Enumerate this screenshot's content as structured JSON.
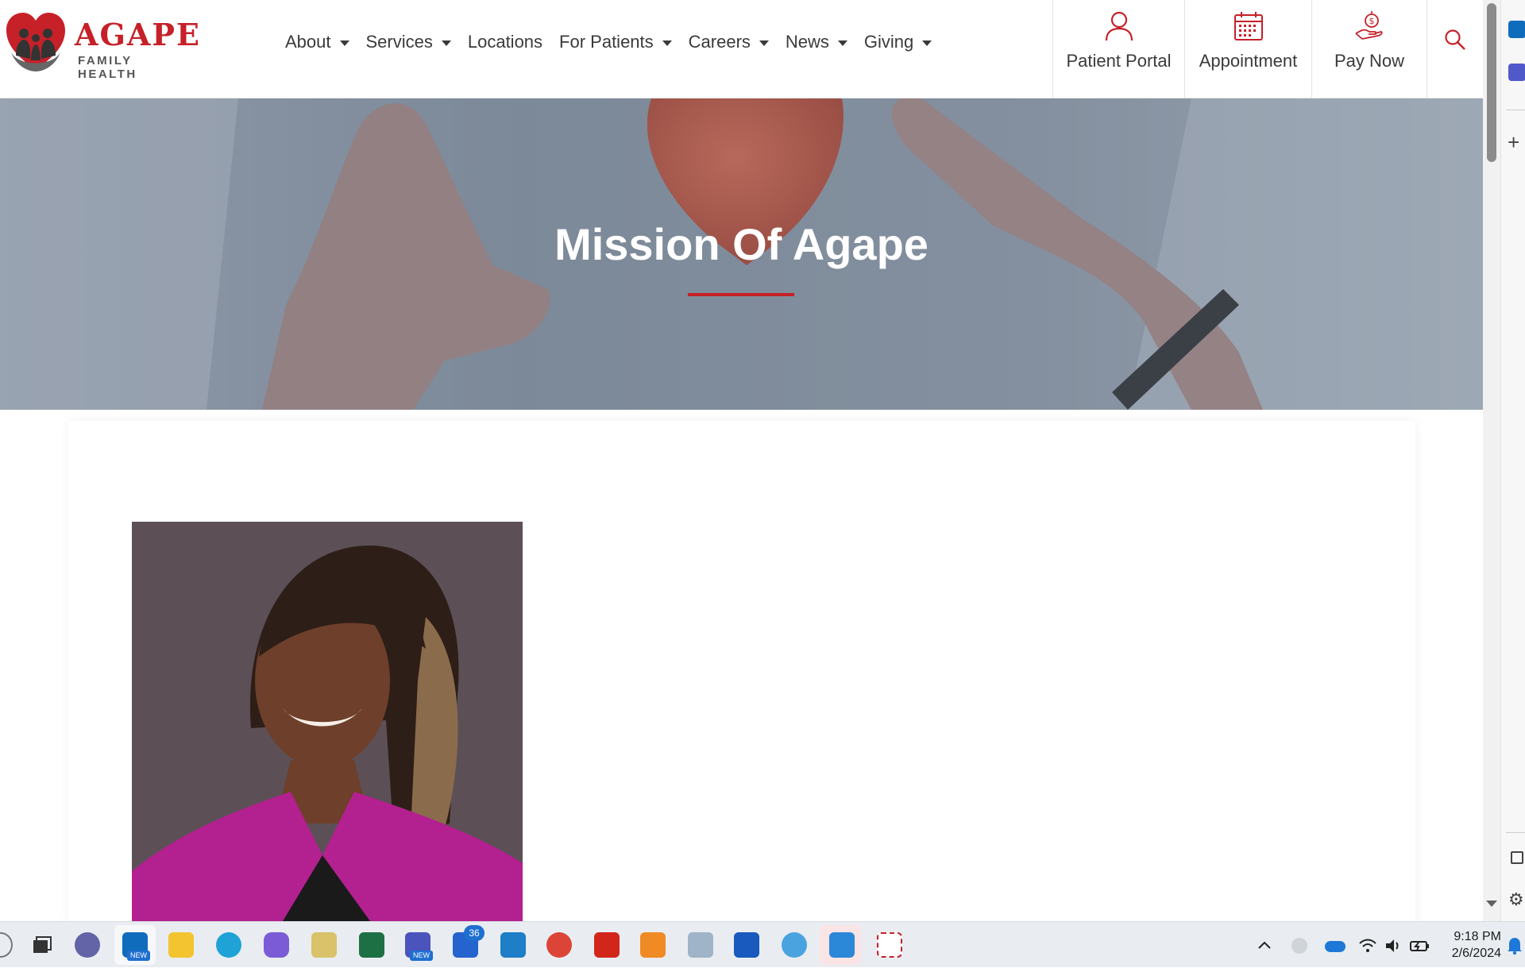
{
  "brand": {
    "name": "AGAPE",
    "tagline": "FAMILY HEALTH",
    "accent": "#c62028"
  },
  "nav": {
    "items": [
      {
        "label": "About",
        "dropdown": true
      },
      {
        "label": "Services",
        "dropdown": true
      },
      {
        "label": "Locations",
        "dropdown": false
      },
      {
        "label": "For Patients",
        "dropdown": true
      },
      {
        "label": "Careers",
        "dropdown": true
      },
      {
        "label": "News",
        "dropdown": true
      },
      {
        "label": "Giving",
        "dropdown": true
      }
    ]
  },
  "quick_links": {
    "portal": "Patient Portal",
    "appointment": "Appointment",
    "pay": "Pay Now"
  },
  "hero": {
    "title": "Mission Of Agape"
  },
  "taskbar": {
    "teams_badge": "NEW",
    "outlook_badge": "NEW",
    "todo_badge": "36",
    "time": "9:18 PM",
    "date": "2/6/2024"
  }
}
